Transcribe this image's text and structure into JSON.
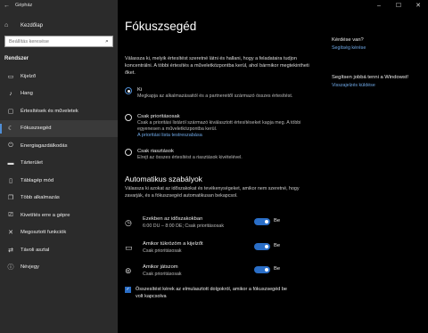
{
  "window": {
    "app_title": "Gépház",
    "controls": {
      "minimize": "–",
      "maximize": "☐",
      "close": "✕"
    }
  },
  "sidebar": {
    "home_label": "Kezdőlap",
    "search_placeholder": "Beállítás keresése",
    "section_label": "Rendszer",
    "items": [
      {
        "label": "Kijelző",
        "icon": "display-icon",
        "glyph": "▭"
      },
      {
        "label": "Hang",
        "icon": "speaker-icon",
        "glyph": "♪"
      },
      {
        "label": "Értesítések és műveletek",
        "icon": "notification-icon",
        "glyph": "▢"
      },
      {
        "label": "Fókuszsegéd",
        "icon": "moon-icon",
        "glyph": "☾"
      },
      {
        "label": "Energiagazdálkodás",
        "icon": "power-icon",
        "glyph": "⏻"
      },
      {
        "label": "Tárterület",
        "icon": "storage-icon",
        "glyph": "▬"
      },
      {
        "label": "Táblagép mód",
        "icon": "tablet-icon",
        "glyph": "▯"
      },
      {
        "label": "Több alkalmazás",
        "icon": "multitasking-icon",
        "glyph": "❐"
      },
      {
        "label": "Kivetítés erre a gépre",
        "icon": "projecting-icon",
        "glyph": "⎚"
      },
      {
        "label": "Megosztott funkciók",
        "icon": "shared-icon",
        "glyph": "✕"
      },
      {
        "label": "Távoli asztal",
        "icon": "remote-desktop-icon",
        "glyph": "⇄"
      },
      {
        "label": "Névjegy",
        "icon": "info-icon",
        "glyph": "ⓘ"
      }
    ]
  },
  "main": {
    "title": "Fókuszsegéd",
    "intro": "Válassza ki, melyik értesítést szeretné látni és hallani, hogy a feladataira tudjon koncentrálni. A többi értesítés a műveletközpontba kerül, ahol bármikor megtekintheti őket.",
    "options": [
      {
        "label": "Ki",
        "desc": "Megkapja az alkalmazásaitól és a partnereitől származó összes értesítést.",
        "selected": true
      },
      {
        "label": "Csak prioritásosak",
        "desc": "Csak a prioritási listáról származó kiválasztott értesítéseket kapja meg. A többi egyenesen a műveletközpontba kerül.",
        "link": "A prioritási lista testreszabása",
        "selected": false
      },
      {
        "label": "Csak riasztások",
        "desc": "Elrejt az összes értesítést a riasztások kivételével.",
        "selected": false
      }
    ],
    "auto_title": "Automatikus szabályok",
    "auto_intro": "Válassza ki azokat az időszakokat és tevékenységeket, amikor nem szeretné, hogy zavarják, és a fókuszsegéd automatikusan bekapcsol.",
    "rules": [
      {
        "icon": "clock-icon",
        "glyph": "◷",
        "title": "Ezekben az időszakokban",
        "sub": "6:00 DU – 8:00 DE; Csak prioritásosak",
        "state": "Be"
      },
      {
        "icon": "monitor-icon",
        "glyph": "▭",
        "title": "Amikor tükrözöm a kijelzőt",
        "sub": "Csak prioritásosak",
        "state": "Be"
      },
      {
        "icon": "gamepad-icon",
        "glyph": "⊚",
        "title": "Amikor játszom",
        "sub": "Csak prioritásosak",
        "state": "Be"
      }
    ],
    "checkbox_label": "Összesítést kérek az elmulasztott dolgokról, amikor a fókuszsegéd be volt kapcsolva"
  },
  "aside": {
    "question": "Kérdése van?",
    "help_link": "Segítség kérése",
    "improve": "Segítsen jobbá tenni a Windowst!",
    "feedback_link": "Visszajelzés küldése"
  },
  "colors": {
    "accent": "#2a6ec7",
    "link": "#6fa9e8",
    "sidebar": "#2b2b2b"
  }
}
